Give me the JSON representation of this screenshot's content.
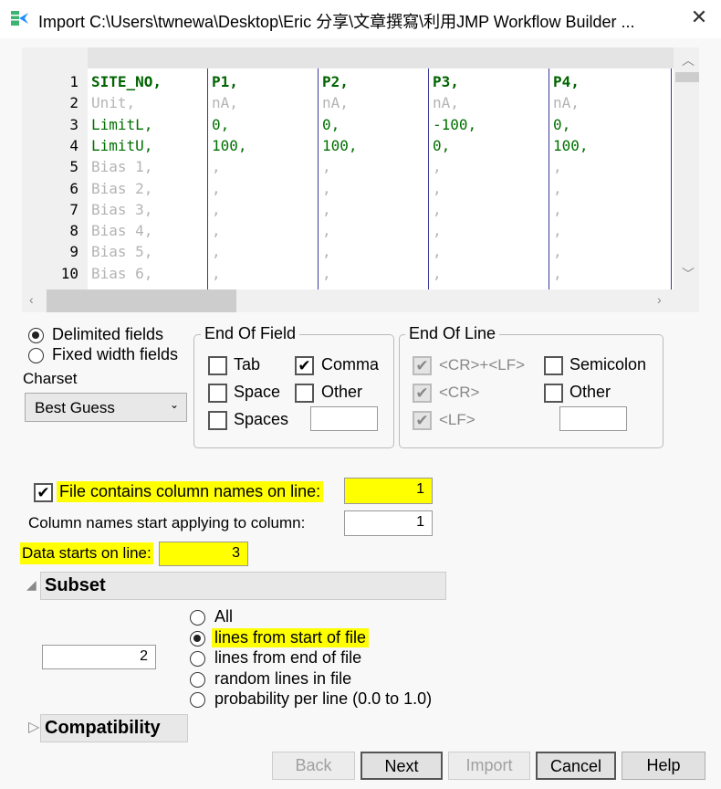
{
  "window": {
    "title": "Import C:\\Users\\twnewa\\Desktop\\Eric 分享\\文章撰寫\\利用JMP Workflow Builder ...",
    "close_icon": "close-icon",
    "app_icon": "jmp-import-icon"
  },
  "preview": {
    "rows": [
      {
        "n": "1",
        "cells": [
          "SITE_NO,",
          "P1,",
          "P2,",
          "P3,",
          "P4,"
        ],
        "style": "bold"
      },
      {
        "n": "2",
        "cells": [
          "Unit,",
          "nA,",
          "nA,",
          "nA,",
          "nA,"
        ],
        "style": "gry"
      },
      {
        "n": "3",
        "cells": [
          "LimitL,",
          "0,",
          "0,",
          "-100,",
          "0,"
        ],
        "style": "grn"
      },
      {
        "n": "4",
        "cells": [
          "LimitU,",
          "100,",
          "100,",
          "0,",
          "100,"
        ],
        "style": "grn"
      },
      {
        "n": "5",
        "cells": [
          "Bias 1,",
          ",",
          ",",
          ",",
          ","
        ],
        "style": "gry"
      },
      {
        "n": "6",
        "cells": [
          "Bias 2,",
          ",",
          ",",
          ",",
          ","
        ],
        "style": "gry"
      },
      {
        "n": "7",
        "cells": [
          "Bias 3,",
          ",",
          ",",
          ",",
          ","
        ],
        "style": "gry"
      },
      {
        "n": "8",
        "cells": [
          "Bias 4,",
          ",",
          ",",
          ",",
          ","
        ],
        "style": "gry"
      },
      {
        "n": "9",
        "cells": [
          "Bias 5,",
          ",",
          ",",
          ",",
          ","
        ],
        "style": "gry"
      },
      {
        "n": "10",
        "cells": [
          "Bias 6,",
          ",",
          ",",
          ",",
          ","
        ],
        "style": "gry"
      }
    ]
  },
  "format": {
    "delimited": "Delimited fields",
    "fixed": "Fixed width fields",
    "selected": "delimited"
  },
  "charset": {
    "label": "Charset",
    "value": "Best Guess"
  },
  "end_of_field": {
    "title": "End Of Field",
    "tab": "Tab",
    "comma": "Comma",
    "space": "Space",
    "other": "Other",
    "spaces": "Spaces",
    "comma_checked": true
  },
  "end_of_line": {
    "title": "End Of Line",
    "crlf": "<CR>+<LF>",
    "cr": "<CR>",
    "lf": "<LF>",
    "semicolon": "Semicolon",
    "other": "Other"
  },
  "column_names": {
    "label": "File contains column names on line:",
    "value": "1",
    "checked": true
  },
  "column_start": {
    "label": "Column names start applying to column:",
    "value": "1"
  },
  "data_start": {
    "label": "Data starts on line:",
    "value": "3"
  },
  "subset": {
    "title": "Subset",
    "count": "2",
    "options": [
      "All",
      "lines from start of file",
      "lines from end of file",
      "random lines in file",
      "probability per line (0.0 to 1.0)"
    ],
    "selected": 1
  },
  "compatibility": {
    "title": "Compatibility"
  },
  "buttons": {
    "back": "Back",
    "next": "Next",
    "import": "Import",
    "cancel": "Cancel",
    "help": "Help"
  },
  "highlight_color": "#ffff00"
}
